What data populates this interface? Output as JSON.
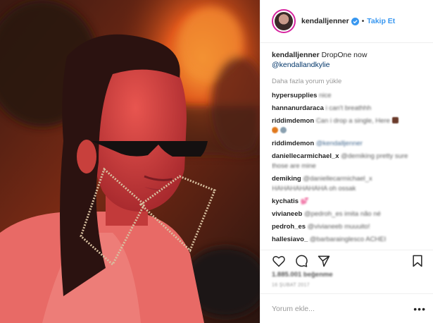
{
  "post": {
    "username": "kendalljenner",
    "follow_label": "Takip Et",
    "separator": "•",
    "caption_user": "kendalljenner",
    "caption_text": "DropOne now",
    "caption_mention": "@kendallandkylie",
    "load_more": "Daha fazla yorum yükle"
  },
  "comments": [
    {
      "user": "hypersupplies",
      "text": "nice",
      "mention": false
    },
    {
      "user": "hannanurdaraca",
      "text": "i can't breathhh",
      "mention": false
    },
    {
      "user": "riddimdemon",
      "text": "Can i drop a single, Here",
      "mention": false,
      "emoji": true
    },
    {
      "user": "riddimdemon",
      "text": "@kendalljenner",
      "mention": true
    },
    {
      "user": "daniellecarmichael_x",
      "text": "@demiking pretty sure those are mine",
      "mention": false
    },
    {
      "user": "demiking",
      "text": "@daniellecarmichael_x HAHAHAHAHAHA oh ossak",
      "mention": false
    },
    {
      "user": "kychatis",
      "text": "💕",
      "mention": false
    },
    {
      "user": "vivianeeb",
      "text": "@pedroh_es imita não né",
      "mention": false
    },
    {
      "user": "pedroh_es",
      "text": "@vivianeeb muuuito!",
      "mention": false
    },
    {
      "user": "hallesiavo_",
      "text": "@barbarainglesco ACHEI",
      "mention": false
    }
  ],
  "footer": {
    "likes_text": "1.885.001 beğenme",
    "date": "16 ŞUBAT 2017",
    "comment_placeholder": "Yorum ekle...",
    "more_label": "•••"
  },
  "icons": {
    "like": "heart-icon",
    "comment": "comment-icon",
    "share": "share-icon",
    "save": "bookmark-icon",
    "verified": "verified-badge-icon"
  },
  "colors": {
    "accent": "#3897f0",
    "mention": "#003569",
    "muted": "#999999",
    "border": "#efefef"
  }
}
